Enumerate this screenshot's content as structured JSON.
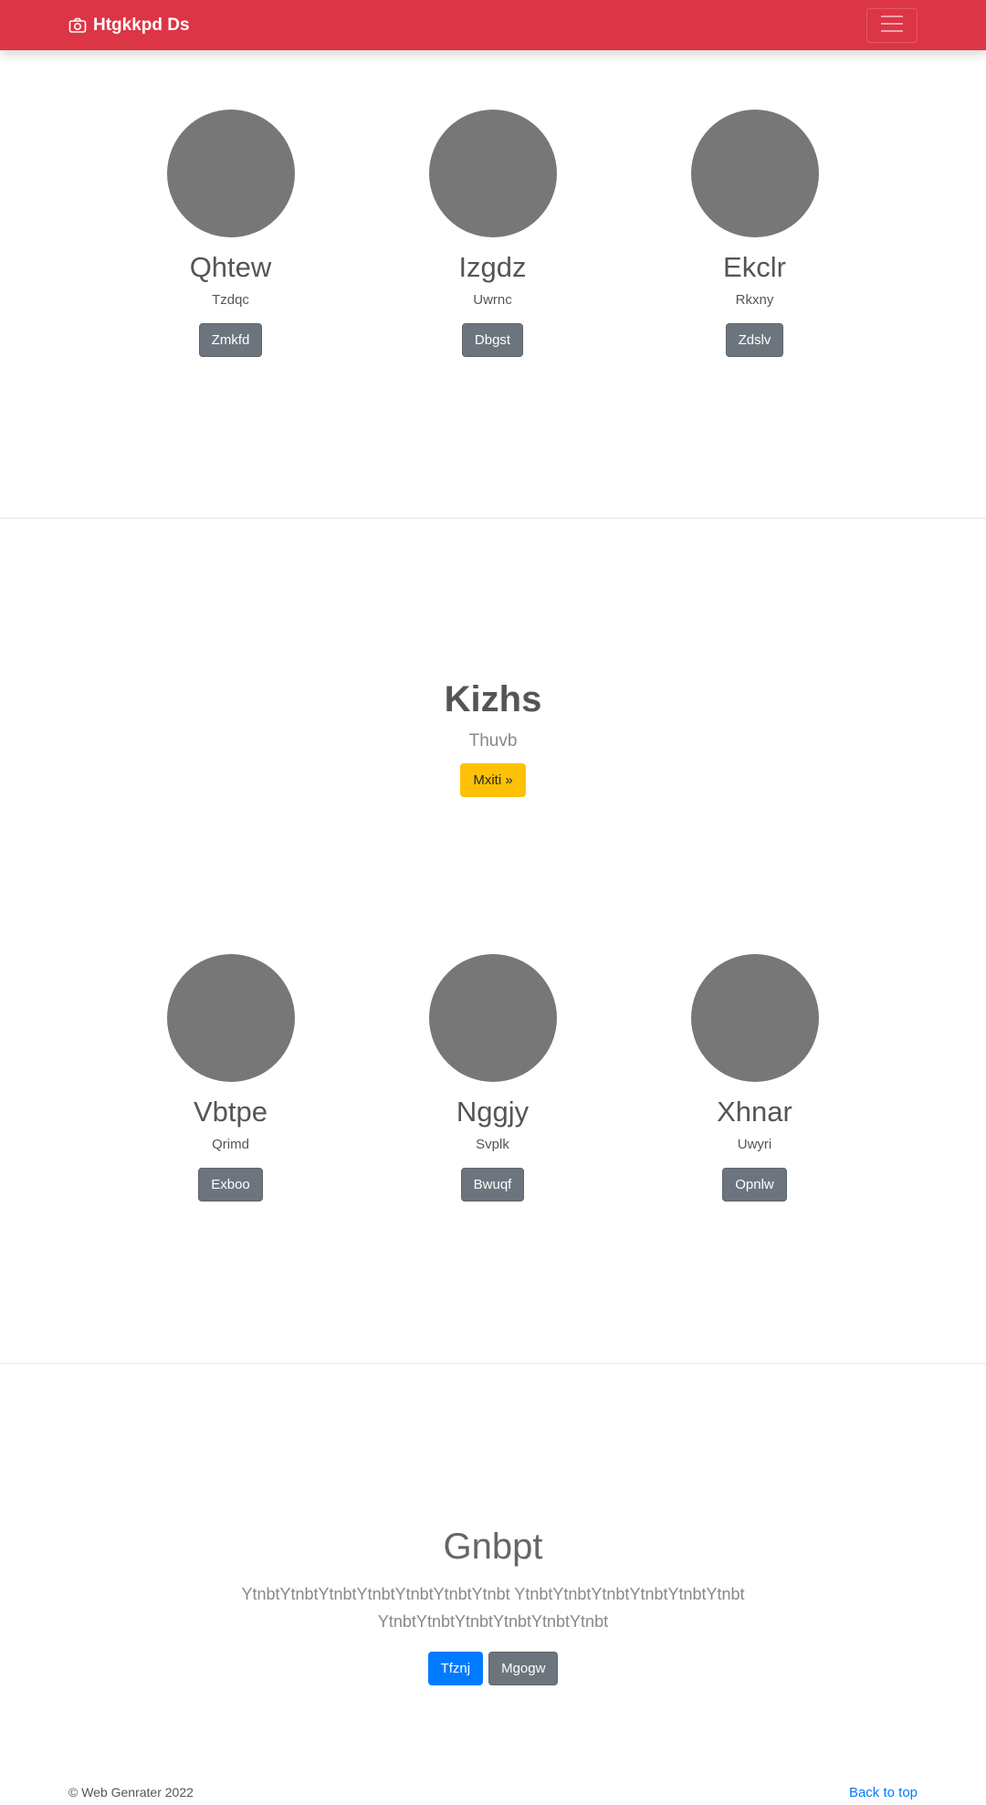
{
  "navbar": {
    "brand": "Htgkkpd Ds",
    "brand_icon": "camera-icon",
    "toggler_icon": "hamburger-icon",
    "color": "#dc3545"
  },
  "features_top": [
    {
      "name": "Qhtew",
      "subtitle": "Tzdqc",
      "button": "Zmkfd"
    },
    {
      "name": "Izgdz",
      "subtitle": "Uwrnc",
      "button": "Dbgst"
    },
    {
      "name": "Ekclr",
      "subtitle": "Rkxny",
      "button": "Zdslv"
    }
  ],
  "hero": {
    "title": "Kizhs",
    "lead": "Thuvb",
    "button": "Mxiti »"
  },
  "features_bottom": [
    {
      "name": "Vbtpe",
      "subtitle": "Qrimd",
      "button": "Exboo"
    },
    {
      "name": "Nggjy",
      "subtitle": "Svplk",
      "button": "Bwuqf"
    },
    {
      "name": "Xhnar",
      "subtitle": "Uwyri",
      "button": "Opnlw"
    }
  ],
  "closing": {
    "title": "Gnbpt",
    "text": "YtnbtYtnbtYtnbtYtnbtYtnbtYtnbtYtnbt YtnbtYtnbtYtnbtYtnbtYtnbtYtnbt YtnbtYtnbtYtnbtYtnbtYtnbtYtnbt",
    "primary_button": "Tfznj",
    "secondary_button": "Mgogw"
  },
  "footer": {
    "copyright": "© Web Genrater 2022",
    "back_to_top": "Back to top"
  }
}
